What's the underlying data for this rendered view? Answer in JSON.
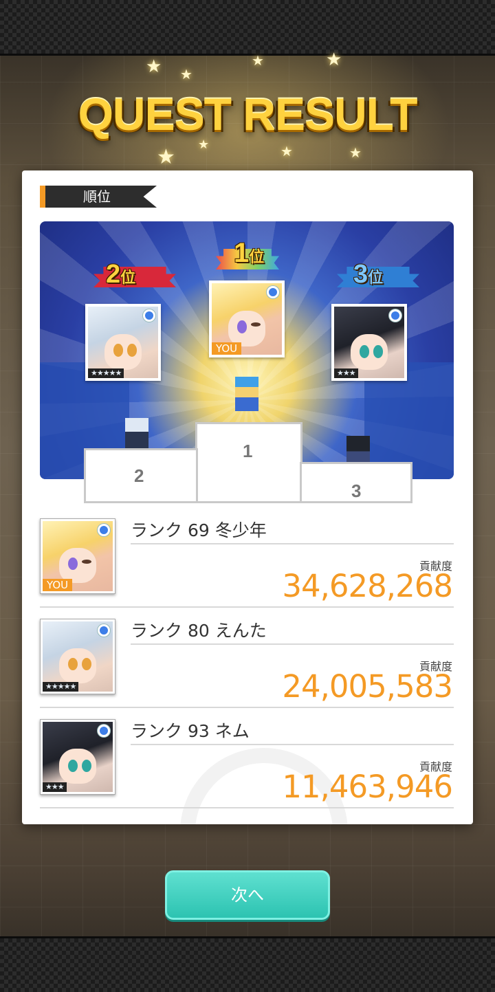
{
  "header": {
    "title": "QUEST RESULT"
  },
  "section": {
    "label": "順位"
  },
  "podium": {
    "first": {
      "place_text": "1",
      "place_suffix": "位",
      "you_label": "YOU",
      "ribbon_color": "#e8c640"
    },
    "second": {
      "place_text": "2",
      "place_suffix": "位",
      "rarity": "★★★★★",
      "ribbon_color": "#d8283a"
    },
    "third": {
      "place_text": "3",
      "place_suffix": "位",
      "rarity": "★★★",
      "ribbon_color": "#2f7fd4"
    },
    "step_labels": [
      "1",
      "2",
      "3"
    ]
  },
  "rankings": [
    {
      "name": "ランク 69 冬少年",
      "contribution_label": "貢献度",
      "score": "34,628,268",
      "you_label": "YOU",
      "portrait": "blonde-girl-portrait"
    },
    {
      "name": "ランク 80 えんた",
      "contribution_label": "貢献度",
      "score": "24,005,583",
      "rarity": "★★★★★",
      "portrait": "silver-hair-portrait"
    },
    {
      "name": "ランク 93 ネム",
      "contribution_label": "貢献度",
      "score": "11,463,946",
      "rarity": "★★★",
      "portrait": "dark-hair-portrait"
    }
  ],
  "footer": {
    "next_label": "次へ"
  },
  "colors": {
    "accent": "#f49a25",
    "button": "#2cc3b1",
    "badge": "#3d7ee8"
  }
}
